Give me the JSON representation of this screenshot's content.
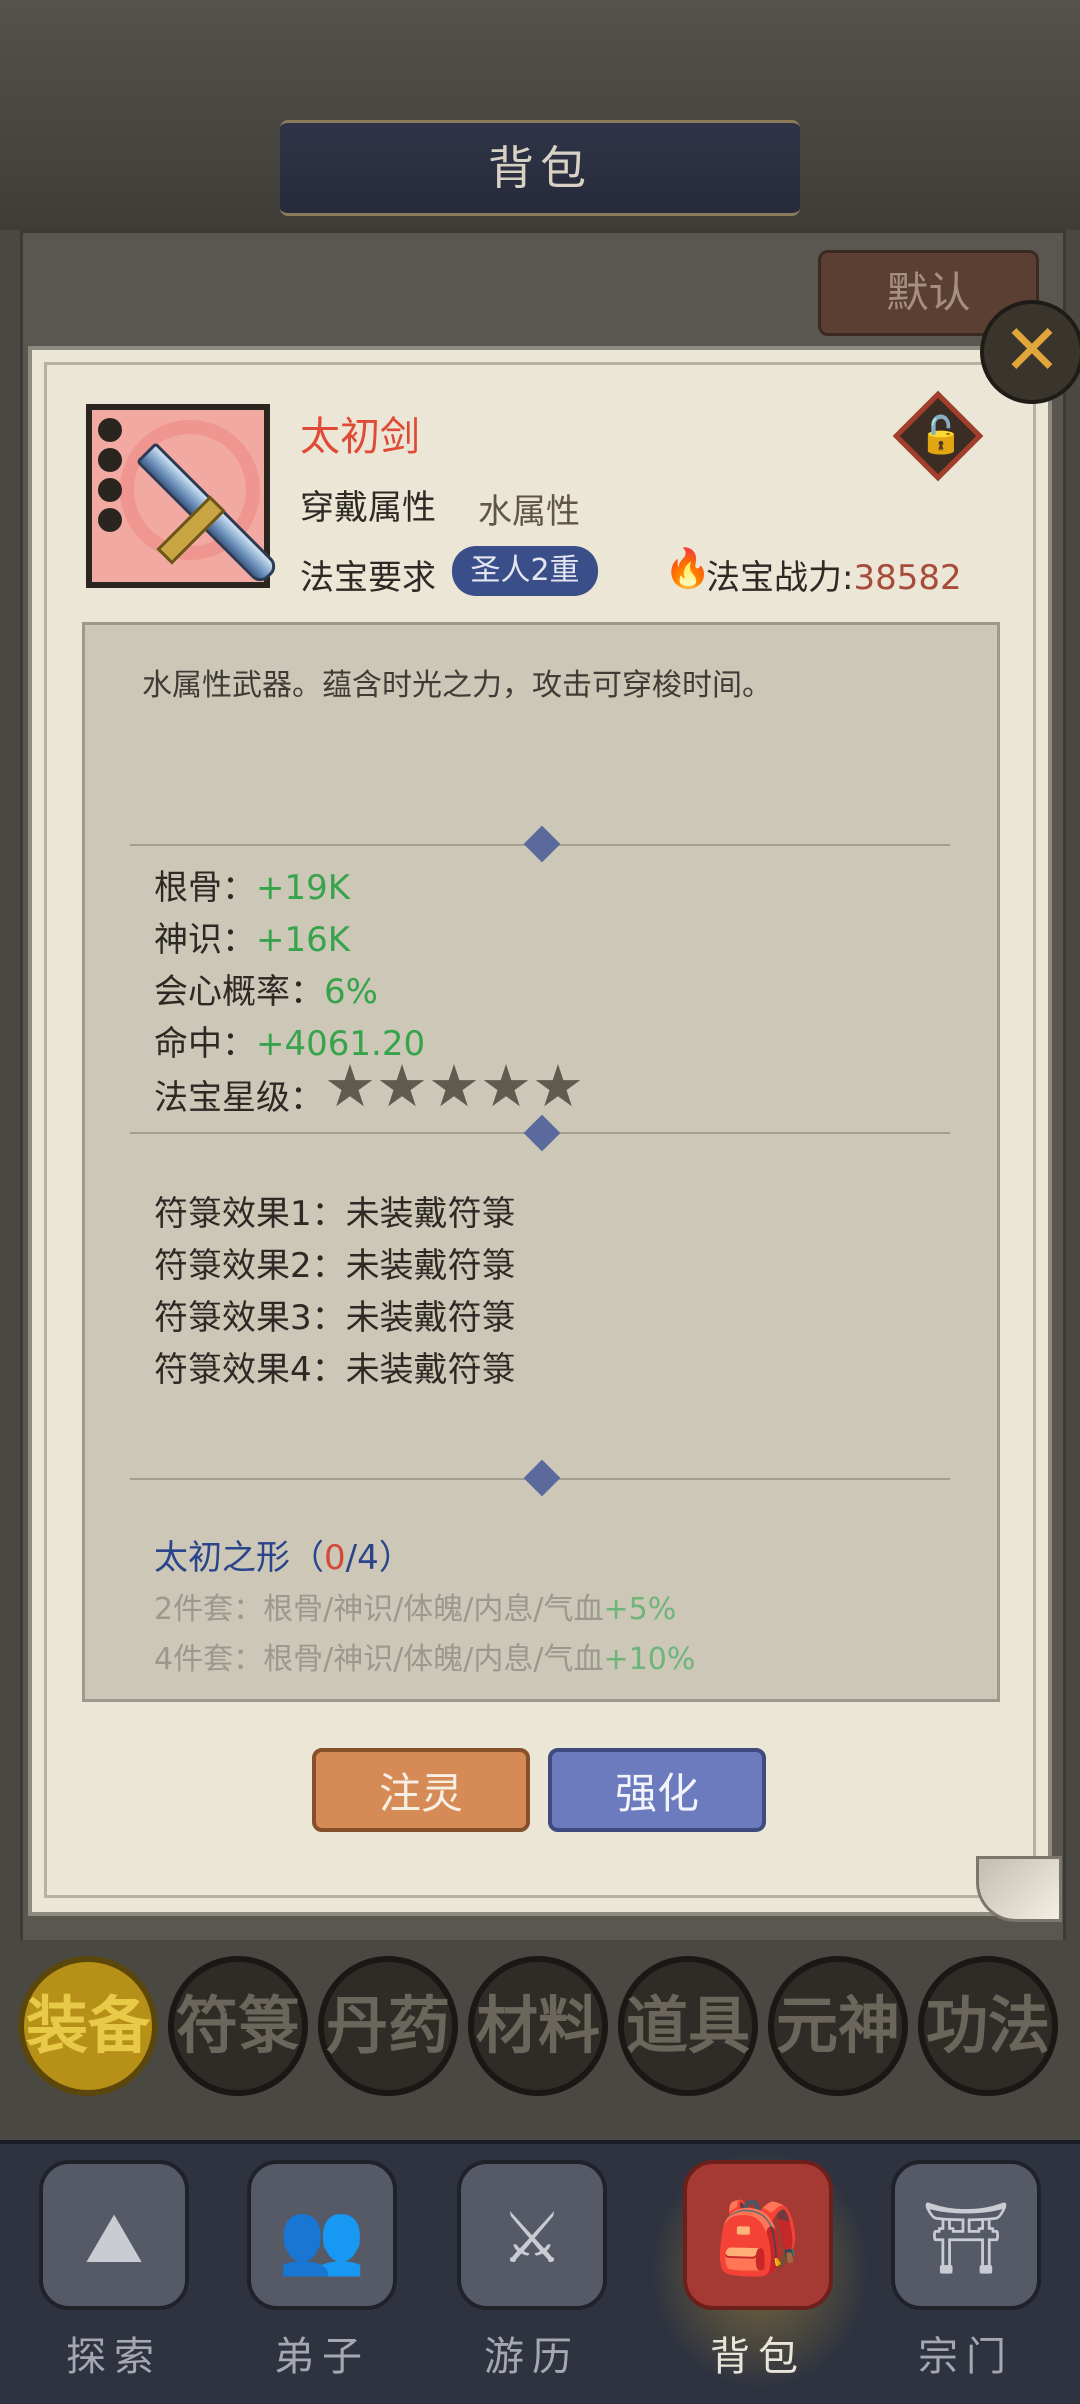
{
  "header": {
    "title": "背包",
    "default_button": "默认"
  },
  "item": {
    "name": "太初剑",
    "wear_attr_label": "穿戴属性",
    "wear_attr_value": "水属性",
    "req_label": "法宝要求",
    "req_value": "圣人2重",
    "power_label": "法宝战力:",
    "power_value": "38582",
    "description": "水属性武器。蕴含时光之力，攻击可穿梭时间。"
  },
  "stats": [
    {
      "label": "根骨：",
      "value": "+19K"
    },
    {
      "label": "神识：",
      "value": "+16K"
    },
    {
      "label": "会心概率：",
      "value": "6%"
    },
    {
      "label": "命中：",
      "value": "+4061.20"
    }
  ],
  "star_label": "法宝星级：",
  "stars": 5,
  "talismans": [
    "符箓效果1：未装戴符箓",
    "符箓效果2：未装戴符箓",
    "符箓效果3：未装戴符箓",
    "符箓效果4：未装戴符箓"
  ],
  "set": {
    "name": "太初之形（",
    "count": "0",
    "total": "/4）",
    "bonus_2_text": "2件套：根骨/神识/体魄/内息/气血",
    "bonus_2_value": "+5%",
    "bonus_4_text": "4件套：根骨/神识/体魄/内息/气血",
    "bonus_4_value": "+10%"
  },
  "buttons": {
    "infuse": "注灵",
    "enhance": "强化"
  },
  "categories": [
    "装备",
    "符箓",
    "丹药",
    "材料",
    "道具",
    "元神",
    "功法"
  ],
  "active_category": "装备",
  "nav": [
    {
      "label": "探索",
      "icon": "mountain-icon"
    },
    {
      "label": "弟子",
      "icon": "disciples-icon"
    },
    {
      "label": "游历",
      "icon": "crossed-swords-icon"
    },
    {
      "label": "背包",
      "icon": "bag-icon"
    },
    {
      "label": "宗门",
      "icon": "temple-icon"
    }
  ],
  "active_nav": "背包",
  "colors": {
    "item_name": "#e04a36",
    "stat_green": "#37a34b",
    "enhance_button": "#6b7bbd",
    "infuse_button": "#d68a55"
  }
}
